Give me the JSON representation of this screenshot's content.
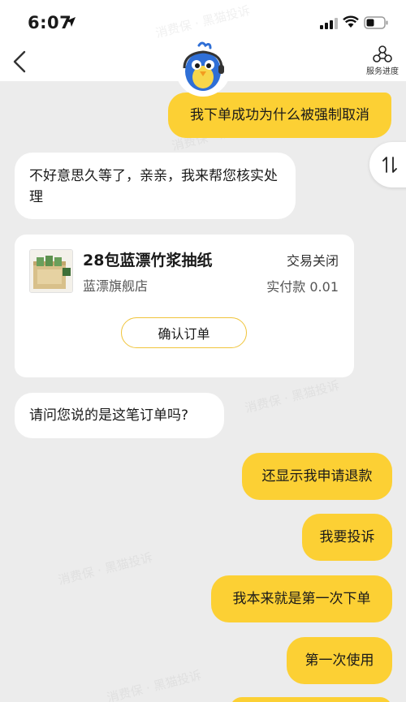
{
  "status_bar": {
    "time": "6:07",
    "icons": [
      "location-arrow-icon",
      "cell-signal-icon",
      "wifi-icon",
      "battery-icon"
    ]
  },
  "header": {
    "back_icon": "chevron-left-icon",
    "mascot_icon": "bird-mascot-avatar",
    "service_progress_label": "服务进度",
    "service_progress_icon": "progress-nodes-icon"
  },
  "messages": {
    "user_1": "我下单成功为什么被强制取消",
    "agent_1": "不好意思久等了，亲亲，我来帮您核实处理",
    "agent_2": "请问您说的是这笔订单吗?",
    "user_2": "还显示我申请退款",
    "user_3": "我要投诉",
    "user_4": "我本来就是第一次下单",
    "user_5": "第一次使用"
  },
  "order_card": {
    "product_name": "28包蓝漂竹浆抽纸",
    "shop_name": "蓝漂旗舰店",
    "status": "交易关闭",
    "paid_amount": "实付款 0.01",
    "confirm_button": "确认订单"
  },
  "swap_button_icon": "swap-vertical-icon",
  "watermark": "消费保 · 黑猫投诉",
  "colors": {
    "user_bubble": "#fcd034",
    "agent_bubble": "#ffffff",
    "background": "#ececec",
    "confirm_border": "#f0c43a"
  }
}
